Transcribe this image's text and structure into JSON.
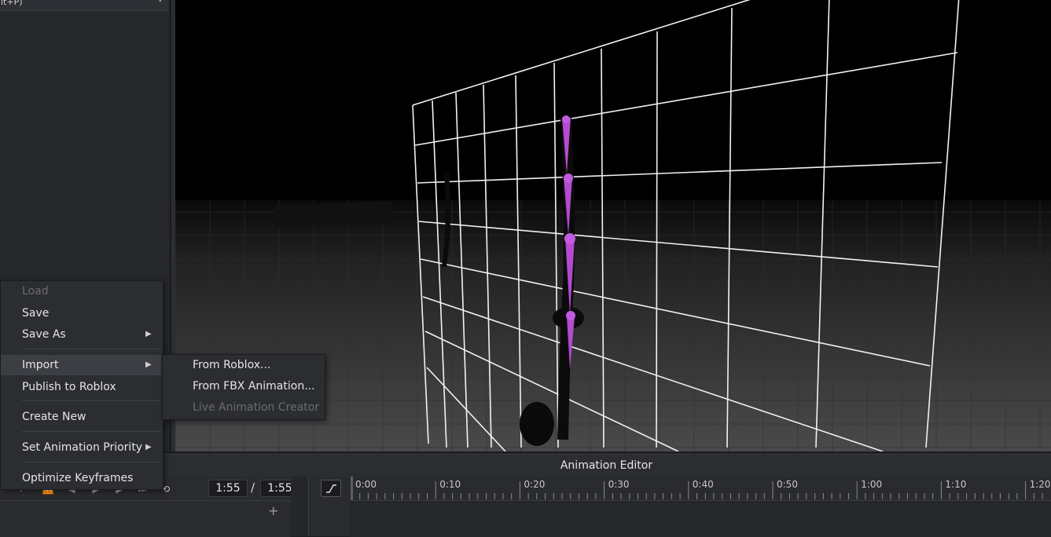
{
  "explorer": {
    "dropdown_text": "lt+P)",
    "dropdown_icon": "chevron-down-icon"
  },
  "viewport": {
    "description_icon": "rig-joint-icon",
    "joint_color": "#b44ad0",
    "grid_color": "#ffffff"
  },
  "editor": {
    "title": "Animation Editor",
    "current_time": "1:55",
    "separator": "/",
    "total_time": "1:55",
    "add_track_label": "+",
    "transport_icons": [
      "skip-start-icon",
      "prev-keyframe-icon",
      "step-back-icon",
      "play-icon",
      "step-forward-icon",
      "skip-end-icon",
      "loop-icon"
    ],
    "timeline_ticks": [
      "0:00",
      "0:10",
      "0:20",
      "0:30",
      "0:40",
      "0:50",
      "1:00",
      "1:10",
      "1:20"
    ]
  },
  "context_menu": {
    "items": [
      {
        "label": "Load",
        "disabled": true
      },
      {
        "label": "Save"
      },
      {
        "label": "Save As",
        "submenu": true
      },
      {
        "label": "Import",
        "submenu": true,
        "active": true
      },
      {
        "label": "Publish to Roblox"
      },
      {
        "label": "Create New"
      },
      {
        "label": "Set Animation Priority",
        "submenu": true
      },
      {
        "label": "Optimize Keyframes"
      }
    ]
  },
  "import_submenu": {
    "items": [
      {
        "label": "From Roblox..."
      },
      {
        "label": "From FBX Animation..."
      },
      {
        "label": "Live Animation Creator",
        "disabled": true
      }
    ]
  }
}
